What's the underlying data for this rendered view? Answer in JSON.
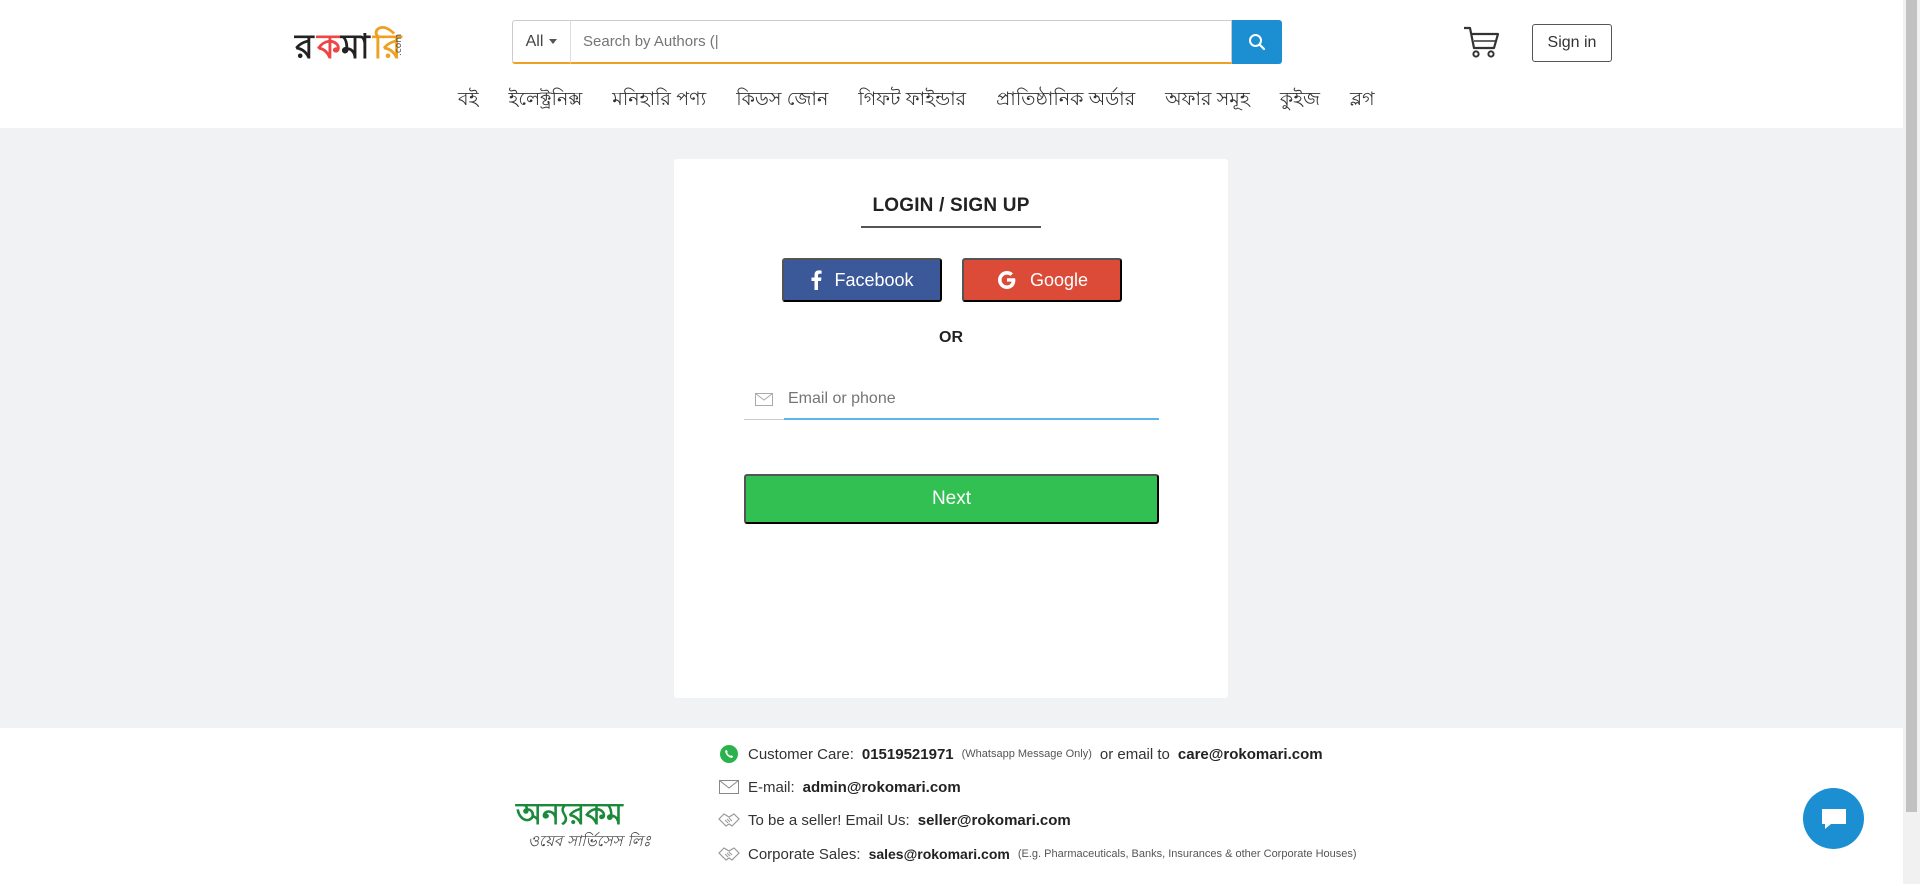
{
  "header": {
    "logo_alt": "রকমারি.com",
    "search": {
      "category": "All",
      "placeholder": "Search by Authors (|"
    },
    "signin_label": "Sign in"
  },
  "nav": {
    "items": [
      "বই",
      "ইলেক্ট্রনিক্স",
      "মনিহারি পণ্য",
      "কিডস জোন",
      "গিফট ফাইন্ডার",
      "প্রাতিষ্ঠানিক অর্ডার",
      "অফার সমূহ",
      "কুইজ",
      "ব্লগ"
    ]
  },
  "login": {
    "title": "LOGIN / SIGN UP",
    "facebook_label": "Facebook",
    "google_label": "Google",
    "or_text": "OR",
    "email_placeholder": "Email or phone",
    "next_label": "Next"
  },
  "footer": {
    "logo_text": "অন্যরকম",
    "logo_sub": "ওয়েব সার্ভিসেস লিঃ",
    "customer_care_label": "Customer Care:",
    "customer_care_phone": "01519521971",
    "customer_care_note": "(Whatsapp Message Only)",
    "or_email_label": "or email to",
    "care_email": "care@rokomari.com",
    "email_label": "E-mail:",
    "admin_email": "admin@rokomari.com",
    "seller_label": "To be a seller! Email Us:",
    "seller_email": "seller@rokomari.com",
    "corporate_label": "Corporate Sales:",
    "corporate_email": "sales@rokomari.com",
    "corporate_note": "(E.g. Pharmaceuticals, Banks, Insurances & other Corporate Houses)"
  },
  "colors": {
    "search_accent": "#f0a020",
    "search_button": "#1b8fd1",
    "facebook": "#3b5998",
    "google": "#dc4a38",
    "next": "#32c052",
    "chat": "#1b8fd1"
  }
}
